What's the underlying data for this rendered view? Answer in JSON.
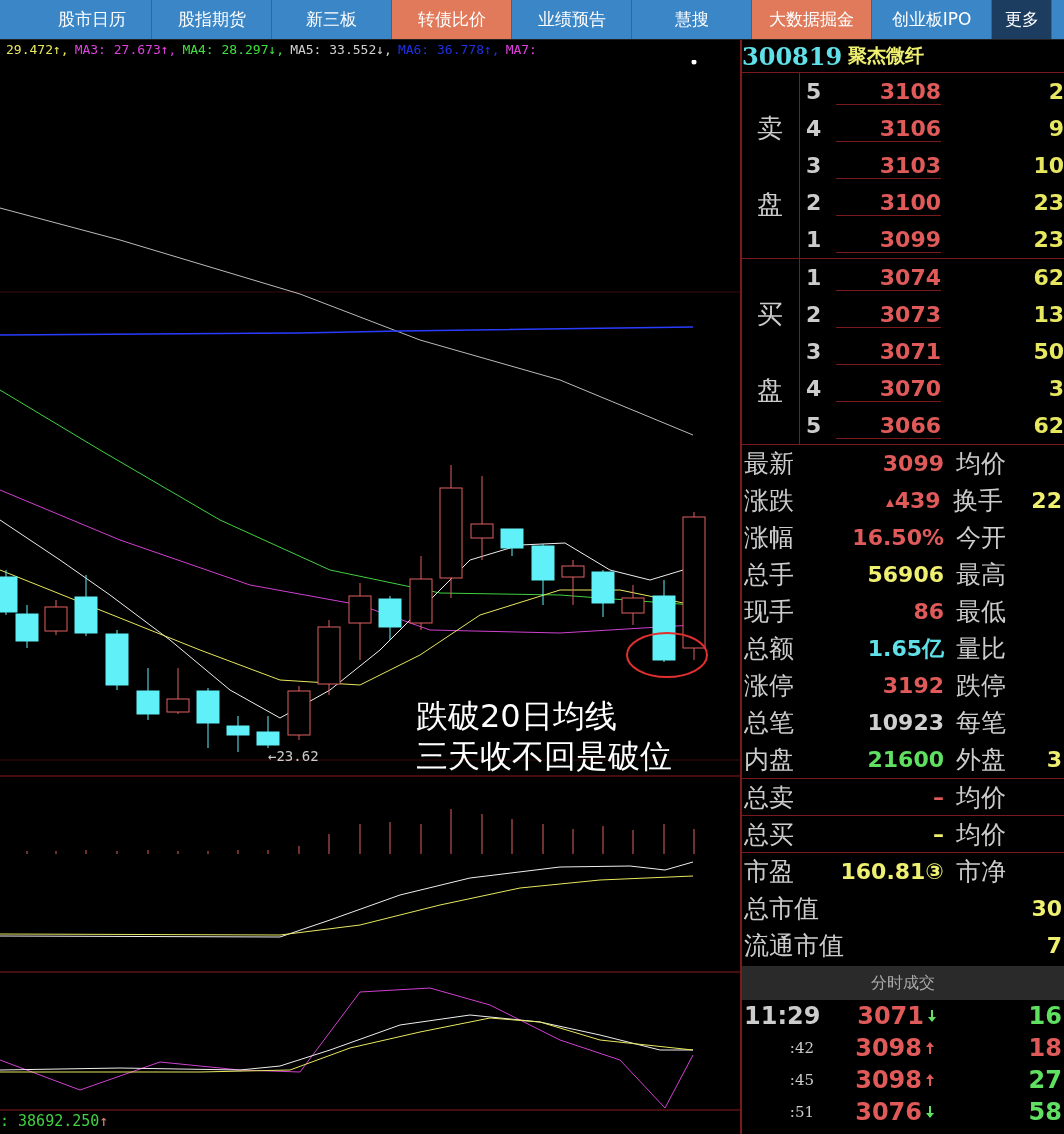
{
  "nav_tabs": [
    {
      "label": "股市日历",
      "kind": "tab",
      "highlighted": false
    },
    {
      "label": "股指期货",
      "kind": "tab",
      "highlighted": false
    },
    {
      "label": "新三板",
      "kind": "tab",
      "highlighted": false
    },
    {
      "label": "转债比价",
      "kind": "tab",
      "highlighted": true
    },
    {
      "label": "业绩预告",
      "kind": "tab",
      "highlighted": false
    },
    {
      "label": "慧搜",
      "kind": "tab",
      "highlighted": false
    },
    {
      "label": "大数据掘金",
      "kind": "tab",
      "highlighted": true
    },
    {
      "label": "创业板IPO",
      "kind": "tab",
      "highlighted": false
    },
    {
      "label": "更多",
      "kind": "more",
      "highlighted": false
    }
  ],
  "ma_legend": [
    {
      "text": "29.472↑,",
      "color": "#e8e860"
    },
    {
      "text": "MA3: 27.673↑,",
      "color": "#e040e0"
    },
    {
      "text": "MA4: 28.297↓,",
      "color": "#40e040"
    },
    {
      "text": "MA5: 33.552↓,",
      "color": "#d0d0d0"
    },
    {
      "text": "MA6: 36.778↑,",
      "color": "#2030e0"
    },
    {
      "text": "MA7:",
      "color": "#e040e0"
    }
  ],
  "chart": {
    "low_label": "←23.62",
    "annotation": [
      "跌破20日均线",
      "三天收不回是破位"
    ],
    "indicator_value": ": 38692.250",
    "indicator_arrow": "↑"
  },
  "quote": {
    "code": "300819",
    "name": "聚杰微纤"
  },
  "order_book": [
    {
      "side_label": "卖盘",
      "levels": [
        {
          "level": "5",
          "price": "3108",
          "volume": "2"
        },
        {
          "level": "4",
          "price": "3106",
          "volume": "9"
        },
        {
          "level": "3",
          "price": "3103",
          "volume": "10"
        },
        {
          "level": "2",
          "price": "3100",
          "volume": "23"
        },
        {
          "level": "1",
          "price": "3099",
          "volume": "23"
        }
      ]
    },
    {
      "side_label": "买盘",
      "levels": [
        {
          "level": "1",
          "price": "3074",
          "volume": "62"
        },
        {
          "level": "2",
          "price": "3073",
          "volume": "13"
        },
        {
          "level": "3",
          "price": "3071",
          "volume": "50"
        },
        {
          "level": "4",
          "price": "3070",
          "volume": "3"
        },
        {
          "level": "5",
          "price": "3066",
          "volume": "62"
        }
      ]
    }
  ],
  "stats": [
    {
      "label": "最新",
      "value": "3099",
      "color": "#e05a5a",
      "rising": false,
      "label2": "均价"
    },
    {
      "label": "涨跌",
      "value": "439",
      "color": "#e05a5a",
      "rising": true,
      "label2": "换手",
      "value2": "22"
    },
    {
      "label": "涨幅",
      "value": "16.50%",
      "color": "#e05a5a",
      "rising": false,
      "label2": "今开"
    },
    {
      "label": "总手",
      "value": "56906",
      "color": "#f0f070",
      "rising": false,
      "label2": "最高"
    },
    {
      "label": "现手",
      "value": "86",
      "color": "#e05a5a",
      "rising": false,
      "label2": "最低"
    },
    {
      "label": "总额",
      "value": "1.65亿",
      "color": "#60e0e8",
      "rising": false,
      "label2": "量比"
    },
    {
      "label": "涨停",
      "value": "3192",
      "color": "#e05a5a",
      "rising": false,
      "label2": "跌停"
    },
    {
      "label": "总笔",
      "value": "10923",
      "color": "#d0d0d0",
      "rising": false,
      "label2": "每笔"
    },
    {
      "label": "内盘",
      "value": "21600",
      "color": "#60e060",
      "rising": false,
      "label2": "外盘",
      "value2": "3"
    }
  ],
  "totals": [
    {
      "label": "总卖",
      "value": "–",
      "color": "#e05a5a",
      "label2": "均价"
    },
    {
      "label": "总买",
      "value": "–",
      "color": "#f0f070",
      "label2": "均价"
    }
  ],
  "valuation": [
    {
      "label": "市盈",
      "value": "160.81③",
      "label2": "市净"
    },
    {
      "label": "总市值",
      "value2": "30"
    },
    {
      "label": "流通市值",
      "value2": "7"
    }
  ],
  "trades_header": "分时成交",
  "trades": [
    {
      "time": "11:29",
      "kind": "minute",
      "price": "3071",
      "up": false,
      "volume": "16",
      "color": "#60e060"
    },
    {
      "time": ":42",
      "kind": "second",
      "price": "3098",
      "up": true,
      "volume": "18",
      "color": "#e05a5a"
    },
    {
      "time": ":45",
      "kind": "second",
      "price": "3098",
      "up": true,
      "volume": "27",
      "color": "#60e060"
    },
    {
      "time": ":51",
      "kind": "second",
      "price": "3076",
      "up": false,
      "volume": "58",
      "color": "#60e060"
    }
  ]
}
